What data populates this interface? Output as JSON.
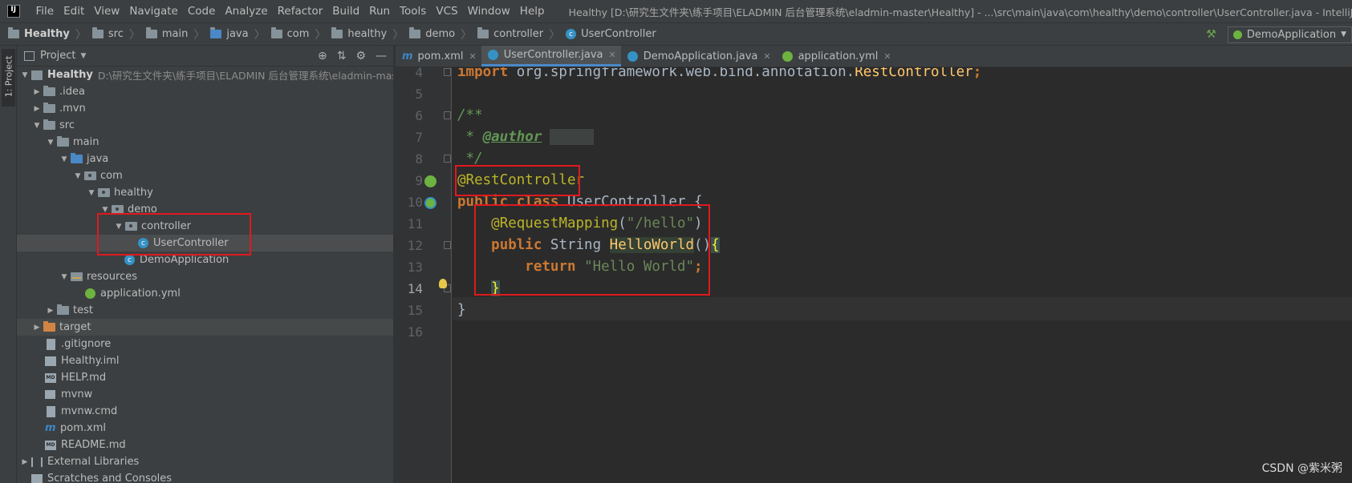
{
  "menubar": {
    "logo": "IJ",
    "items": [
      "File",
      "Edit",
      "View",
      "Navigate",
      "Code",
      "Analyze",
      "Refactor",
      "Build",
      "Run",
      "Tools",
      "VCS",
      "Window",
      "Help"
    ],
    "window_title": "Healthy [D:\\研究生文件夹\\练手项目\\ELADMIN 后台管理系统\\eladmin-master\\Healthy] - ...\\src\\main\\java\\com\\healthy\\demo\\controller\\UserController.java - IntelliJ IDEA"
  },
  "breadcrumbs": [
    "Healthy",
    "src",
    "main",
    "java",
    "com",
    "healthy",
    "demo",
    "controller",
    "UserController"
  ],
  "run_config": {
    "label": "DemoApplication"
  },
  "left_stripe": {
    "tab_label": "1: Project"
  },
  "project_panel": {
    "title": "Project",
    "root": {
      "name": "Healthy",
      "path": "D:\\研究生文件夹\\练手项目\\ELADMIN 后台管理系统\\eladmin-master\\Healthy"
    },
    "nodes": [
      ".idea",
      ".mvn",
      "src",
      "main",
      "java",
      "com",
      "healthy",
      "demo",
      "controller",
      "UserController",
      "DemoApplication",
      "resources",
      "application.yml",
      "test",
      "target",
      ".gitignore",
      "Healthy.iml",
      "HELP.md",
      "mvnw",
      "mvnw.cmd",
      "pom.xml",
      "README.md",
      "External Libraries",
      "Scratches and Consoles"
    ]
  },
  "editor_tabs": [
    "pom.xml",
    "UserController.java",
    "DemoApplication.java",
    "application.yml"
  ],
  "editor": {
    "line_numbers": [
      "4",
      "5",
      "6",
      "7",
      "8",
      "9",
      "10",
      "11",
      "12",
      "13",
      "14",
      "15",
      "16"
    ],
    "code": {
      "l4_kw": "import",
      "l4_path": " org.springframework.web.bind.annotation.",
      "l4_cls": "RestController",
      "l4_end": ";",
      "l6": "/**",
      "l7_star": " * ",
      "l7_tag": "@author",
      "l8": " */",
      "l9": "@RestController",
      "l10_kw1": "public",
      "l10_kw2": "class",
      "l10_name": " UserController ",
      "l10_brace": "{",
      "l11_ann": "@RequestMapping",
      "l11_open": "(",
      "l11_str": "\"/hello\"",
      "l11_close": ")",
      "l12_kw": "public",
      "l12_type": " String ",
      "l12_fn": "HelloWorld",
      "l12_parens": "()",
      "l12_brace": "{",
      "l13_kw": "return",
      "l13_str": "\"Hello World\"",
      "l13_end": ";",
      "l14": "}",
      "l15": "}"
    }
  },
  "watermark": "CSDN @紫米粥"
}
